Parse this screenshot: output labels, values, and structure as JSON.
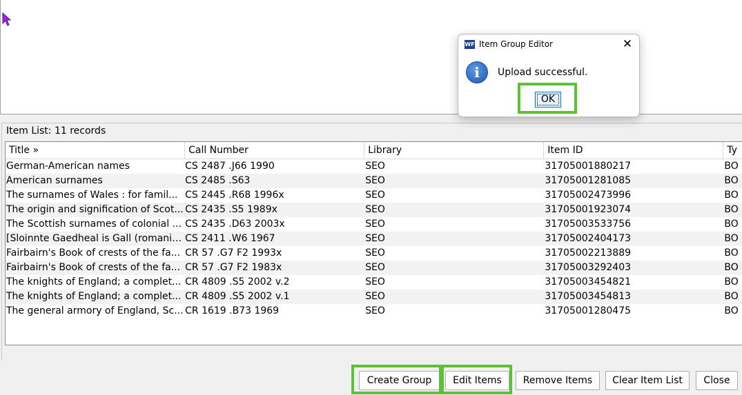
{
  "item_list": {
    "title": "Item List: 11 records",
    "columns": [
      "Title »",
      "Call Number",
      "Library",
      "Item ID",
      "Ty"
    ],
    "rows": [
      {
        "title": "German-American names",
        "call_number": "CS 2487 .J66 1990",
        "library": "SEO",
        "item_id": "31705001880217",
        "type": "BO"
      },
      {
        "title": "American surnames",
        "call_number": "CS 2485 .S63",
        "library": "SEO",
        "item_id": "31705001281085",
        "type": "BO"
      },
      {
        "title": "The surnames of Wales : for famil...",
        "call_number": "CS 2445 .R68 1996x",
        "library": "SEO",
        "item_id": "31705002473996",
        "type": "BO"
      },
      {
        "title": "The origin and signification of Scot...",
        "call_number": "CS 2435 .S5 1989x",
        "library": "SEO",
        "item_id": "31705001923074",
        "type": "BO"
      },
      {
        "title": "The Scottish surnames of colonial ...",
        "call_number": "CS 2435 .D63 2003x",
        "library": "SEO",
        "item_id": "31705003533756",
        "type": "BO"
      },
      {
        "title": "[Sloinnte Gaedheal is Gall (romaniz...",
        "call_number": "CS 2411 .W6 1967",
        "library": "SEO",
        "item_id": "31705002404173",
        "type": "BO"
      },
      {
        "title": "Fairbairn's Book of crests of the fa...",
        "call_number": "CR 57 .G7 F2 1993x",
        "library": "SEO",
        "item_id": "31705002213889",
        "type": "BO"
      },
      {
        "title": "Fairbairn's Book of crests of the fa...",
        "call_number": "CR 57 .G7 F2 1983x",
        "library": "SEO",
        "item_id": "31705003292403",
        "type": "BO"
      },
      {
        "title": "The knights of England; a complet...",
        "call_number": "CR 4809 .S5 2002 v.2",
        "library": "SEO",
        "item_id": "31705003454821",
        "type": "BO"
      },
      {
        "title": "The knights of England; a complet...",
        "call_number": "CR 4809 .S5 2002 v.1",
        "library": "SEO",
        "item_id": "31705003454813",
        "type": "BO"
      },
      {
        "title": "The general armory of England, Sc...",
        "call_number": "CR 1619 .B73 1969",
        "library": "SEO",
        "item_id": "31705001280475",
        "type": "BO"
      }
    ]
  },
  "buttons": {
    "create_group": "Create Group",
    "edit_items": "Edit Items",
    "remove_items": "Remove Items",
    "clear_item_list": "Clear Item List",
    "close": "Close"
  },
  "dialog": {
    "app_icon": "WF",
    "title": "Item Group Editor",
    "close_glyph": "✕",
    "icon": "info-icon",
    "message": "Upload successful.",
    "ok": "OK"
  },
  "colors": {
    "highlight": "#5bc236",
    "info_icon": "#1c56b4"
  }
}
